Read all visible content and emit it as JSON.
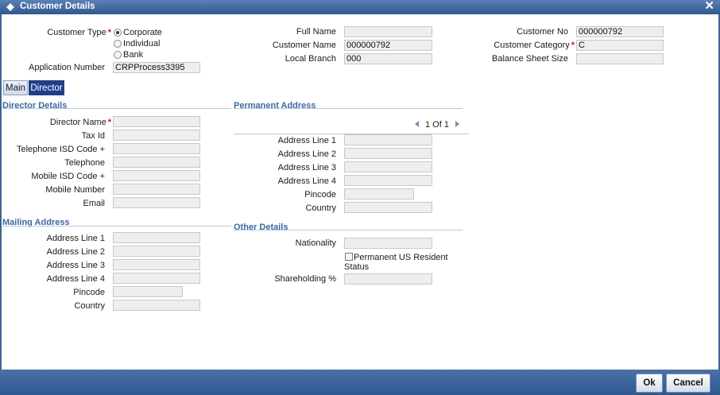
{
  "window": {
    "title": "Customer Details",
    "close_glyph": "✕"
  },
  "header": {
    "customer_type_label": "Customer Type",
    "customer_type_options": [
      "Corporate",
      "Individual",
      "Bank"
    ],
    "customer_type_selected": "Corporate",
    "application_number_label": "Application Number",
    "application_number_value": "CRPProcess3395",
    "full_name_label": "Full Name",
    "full_name_value": "",
    "customer_name_label": "Customer Name",
    "customer_name_value": "000000792",
    "local_branch_label": "Local Branch",
    "local_branch_value": "000",
    "customer_no_label": "Customer No",
    "customer_no_value": "000000792",
    "customer_category_label": "Customer Category",
    "customer_category_value": "C",
    "balance_sheet_size_label": "Balance Sheet Size",
    "balance_sheet_size_value": ""
  },
  "tabs": [
    {
      "label": "Main",
      "active": false
    },
    {
      "label": "Director",
      "active": true
    }
  ],
  "director_details": {
    "title": "Director Details",
    "director_name_label": "Director Name",
    "tax_id_label": "Tax Id",
    "telephone_isd_label": "Telephone ISD Code +",
    "telephone_label": "Telephone",
    "mobile_isd_label": "Mobile ISD Code +",
    "mobile_number_label": "Mobile Number",
    "email_label": "Email"
  },
  "mailing_address": {
    "title": "Mailing Address",
    "line1_label": "Address Line 1",
    "line2_label": "Address Line 2",
    "line3_label": "Address Line 3",
    "line4_label": "Address Line 4",
    "pincode_label": "Pincode",
    "country_label": "Country"
  },
  "permanent_address": {
    "title": "Permanent Address",
    "pager_text": "1 Of 1",
    "line1_label": "Address Line 1",
    "line2_label": "Address Line 2",
    "line3_label": "Address Line 3",
    "line4_label": "Address Line 4",
    "pincode_label": "Pincode",
    "country_label": "Country"
  },
  "other_details": {
    "title": "Other Details",
    "nationality_label": "Nationality",
    "us_resident_label_line1": "Permanent US Resident",
    "us_resident_label_line2": "Status",
    "shareholding_label": "Shareholding %"
  },
  "footer": {
    "ok_label": "Ok",
    "cancel_label": "Cancel"
  },
  "colors": {
    "title_bar": "#2f5891",
    "section_heading": "#3c68a8",
    "active_tab": "#1f3f8a",
    "required": "#d2161e"
  },
  "icons": {
    "title_icon": "diamond-icon",
    "close": "close-icon",
    "prev": "prev-record-icon",
    "next": "next-record-icon"
  }
}
